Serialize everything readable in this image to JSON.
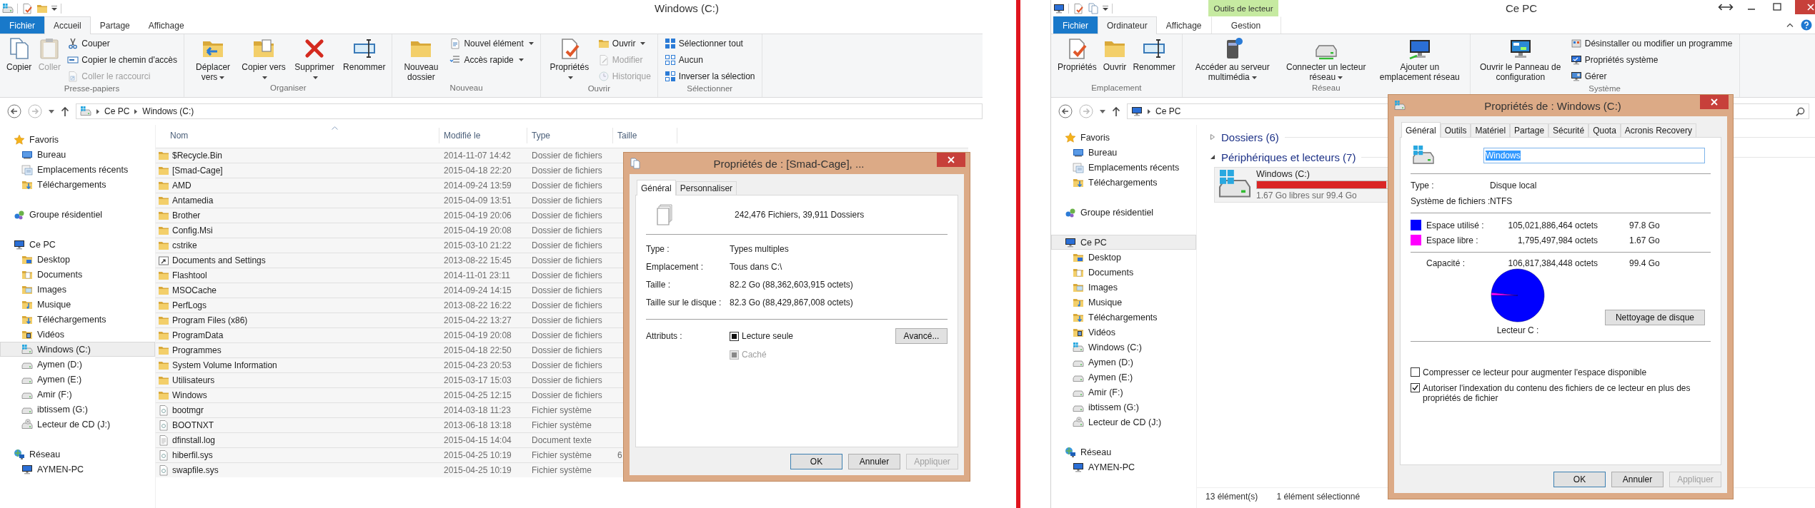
{
  "left_window": {
    "title": "Windows (C:)",
    "tabs": [
      {
        "label": "Fichier",
        "kind": "file",
        "selected": false
      },
      {
        "label": "Accueil",
        "kind": "plain",
        "selected": true
      },
      {
        "label": "Partage",
        "kind": "plain",
        "selected": false
      },
      {
        "label": "Affichage",
        "kind": "plain",
        "selected": false
      }
    ],
    "ribbon_groups": [
      {
        "label": "Presse-papiers",
        "large": [
          {
            "label": "Copier",
            "kind": "copy",
            "disabled": false
          },
          {
            "label": "Coller",
            "kind": "paste",
            "disabled": true
          }
        ],
        "small": [
          {
            "label": "Couper",
            "kind": "cut",
            "disabled": false
          },
          {
            "label": "Copier le chemin d'accès",
            "kind": "path",
            "disabled": false
          },
          {
            "label": "Coller le raccourci",
            "kind": "shortcut",
            "disabled": true
          }
        ]
      },
      {
        "label": "Organiser",
        "large": [
          {
            "label": "Déplacer vers",
            "kind": "move",
            "disabled": false,
            "dropdown": true
          },
          {
            "label": "Copier vers",
            "kind": "copyto",
            "disabled": false,
            "dropdown": true
          },
          {
            "label": "Supprimer",
            "kind": "delete",
            "disabled": false,
            "dropdown": true
          },
          {
            "label": "Renommer",
            "kind": "rename",
            "disabled": false
          }
        ]
      },
      {
        "label": "Nouveau",
        "large": [
          {
            "label": "Nouveau dossier",
            "kind": "newfolder",
            "disabled": false
          }
        ],
        "small": [
          {
            "label": "Nouvel élément",
            "kind": "newitem",
            "disabled": false,
            "dropdown": true
          },
          {
            "label": "Accès rapide",
            "kind": "quick",
            "disabled": false,
            "dropdown": true
          }
        ]
      },
      {
        "label": "Ouvrir",
        "large": [
          {
            "label": "Propriétés",
            "kind": "properties",
            "disabled": false,
            "dropdown": true
          }
        ],
        "small": [
          {
            "label": "Ouvrir",
            "kind": "open",
            "disabled": false,
            "dropdown": true
          },
          {
            "label": "Modifier",
            "kind": "edit",
            "disabled": true
          },
          {
            "label": "Historique",
            "kind": "history",
            "disabled": true
          }
        ]
      },
      {
        "label": "Sélectionner",
        "small": [
          {
            "label": "Sélectionner tout",
            "kind": "selectall",
            "disabled": false
          },
          {
            "label": "Aucun",
            "kind": "selectnone",
            "disabled": false
          },
          {
            "label": "Inverser la sélection",
            "kind": "invert",
            "disabled": false
          }
        ]
      }
    ],
    "address": [
      "Ce PC",
      "Windows (C:)"
    ],
    "sidebar": [
      {
        "label": "Favoris",
        "kind": "star",
        "selected": false,
        "children": [
          {
            "label": "Bureau",
            "kind": "desktop",
            "selected": false
          },
          {
            "label": "Emplacements récents",
            "kind": "recent",
            "selected": false
          },
          {
            "label": "Téléchargements",
            "kind": "downloads",
            "selected": false
          }
        ]
      },
      {
        "label": "Groupe résidentiel",
        "kind": "homegroup",
        "selected": false
      },
      {
        "label": "Ce PC",
        "kind": "pc",
        "selected": false,
        "children": [
          {
            "label": "Desktop",
            "kind": "desktopfolder",
            "selected": false
          },
          {
            "label": "Documents",
            "kind": "documents",
            "selected": false
          },
          {
            "label": "Images",
            "kind": "pictures",
            "selected": false
          },
          {
            "label": "Musique",
            "kind": "music",
            "selected": false
          },
          {
            "label": "Téléchargements",
            "kind": "downloads",
            "selected": false
          },
          {
            "label": "Vidéos",
            "kind": "videos",
            "selected": false
          },
          {
            "label": "Windows (C:)",
            "kind": "windrive",
            "selected": true
          },
          {
            "label": "Aymen (D:)",
            "kind": "drive",
            "selected": false
          },
          {
            "label": "Aymen (E:)",
            "kind": "drive",
            "selected": false
          },
          {
            "label": "Amir (F:)",
            "kind": "drive",
            "selected": false
          },
          {
            "label": "ibtissem (G:)",
            "kind": "drive",
            "selected": false
          },
          {
            "label": "Lecteur de CD (J:)",
            "kind": "cd",
            "selected": false
          }
        ]
      },
      {
        "label": "Réseau",
        "kind": "network",
        "selected": false,
        "children": [
          {
            "label": "AYMEN-PC",
            "kind": "pc",
            "selected": false
          }
        ]
      }
    ],
    "columns": [
      "Nom",
      "Modifié le",
      "Type",
      "Taille"
    ],
    "rows": [
      {
        "name": "$Recycle.Bin",
        "kind": "folder",
        "modified": "2014-11-07 14:42",
        "type": "Dossier de fichiers"
      },
      {
        "name": "[Smad-Cage]",
        "kind": "folder",
        "modified": "2015-04-18 22:20",
        "type": "Dossier de fichiers"
      },
      {
        "name": "AMD",
        "kind": "folder",
        "modified": "2014-09-24 13:59",
        "type": "Dossier de fichiers"
      },
      {
        "name": "Antamedia",
        "kind": "folder",
        "modified": "2015-04-09 13:51",
        "type": "Dossier de fichiers"
      },
      {
        "name": "Brother",
        "kind": "folder",
        "modified": "2015-04-19 20:06",
        "type": "Dossier de fichiers"
      },
      {
        "name": "Config.Msi",
        "kind": "folder",
        "modified": "2015-04-19 20:08",
        "type": "Dossier de fichiers"
      },
      {
        "name": "cstrike",
        "kind": "folder",
        "modified": "2015-03-10 21:22",
        "type": "Dossier de fichiers"
      },
      {
        "name": "Documents and Settings",
        "kind": "link",
        "modified": "2013-08-22 15:45",
        "type": "Dossier de fichiers"
      },
      {
        "name": "Flashtool",
        "kind": "folder",
        "modified": "2014-11-01 23:11",
        "type": "Dossier de fichiers"
      },
      {
        "name": "MSOCache",
        "kind": "folder",
        "modified": "2014-09-24 14:15",
        "type": "Dossier de fichiers"
      },
      {
        "name": "PerfLogs",
        "kind": "folder",
        "modified": "2013-08-22 16:22",
        "type": "Dossier de fichiers"
      },
      {
        "name": "Program Files (x86)",
        "kind": "folder",
        "modified": "2015-04-22 13:27",
        "type": "Dossier de fichiers"
      },
      {
        "name": "ProgramData",
        "kind": "folder",
        "modified": "2015-04-19 20:08",
        "type": "Dossier de fichiers"
      },
      {
        "name": "Programmes",
        "kind": "folder",
        "modified": "2015-04-18 22:50",
        "type": "Dossier de fichiers"
      },
      {
        "name": "System Volume Information",
        "kind": "folder",
        "modified": "2015-04-23 20:53",
        "type": "Dossier de fichiers"
      },
      {
        "name": "Utilisateurs",
        "kind": "folder",
        "modified": "2015-03-17 15:03",
        "type": "Dossier de fichiers"
      },
      {
        "name": "Windows",
        "kind": "folder",
        "modified": "2015-04-25 12:15",
        "type": "Dossier de fichiers"
      },
      {
        "name": "bootmgr",
        "kind": "sysfile",
        "modified": "2014-03-18 11:23",
        "type": "Fichier système"
      },
      {
        "name": "BOOTNXT",
        "kind": "sysfile",
        "modified": "2013-06-18 13:18",
        "type": "Fichier système"
      },
      {
        "name": "dfinstall.log",
        "kind": "textfile",
        "modified": "2015-04-15 14:04",
        "type": "Document texte"
      },
      {
        "name": "hiberfil.sys",
        "kind": "sysfile",
        "modified": "2015-04-25 10:19",
        "type": "Fichier système",
        "size": "6"
      },
      {
        "name": "swapfile.sys",
        "kind": "sysfile",
        "modified": "2015-04-25 10:19",
        "type": "Fichier système"
      }
    ]
  },
  "left_dialog": {
    "title": "Propriétés de : [Smad-Cage], ...",
    "tabs": [
      {
        "label": "Général",
        "selected": true
      },
      {
        "label": "Personnaliser",
        "selected": false
      }
    ],
    "summary": "242,476 Fichiers, 39,911 Dossiers",
    "fields": [
      {
        "label": "Type :",
        "value": "Types multiples"
      },
      {
        "label": "Emplacement :",
        "value": "Tous dans C:\\"
      },
      {
        "label": "Taille :",
        "value": "82.2 Go (88,362,603,915 octets)"
      },
      {
        "label": "Taille sur le disque :",
        "value": "82.3 Go (88,429,867,008 octets)"
      }
    ],
    "attributes_label": "Attributs :",
    "attributes": [
      {
        "label": "Lecture seule",
        "indeterminate": true,
        "disabled": false
      },
      {
        "label": "Caché",
        "indeterminate": true,
        "disabled": true
      }
    ],
    "advanced_button": "Avancé...",
    "buttons": [
      {
        "label": "OK",
        "default": true,
        "disabled": false
      },
      {
        "label": "Annuler",
        "default": false,
        "disabled": false
      },
      {
        "label": "Appliquer",
        "default": false,
        "disabled": true
      }
    ]
  },
  "right_window": {
    "title": "Ce PC",
    "context_tab": "Outils de lecteur",
    "tabs": [
      {
        "label": "Fichier",
        "kind": "file",
        "selected": false
      },
      {
        "label": "Ordinateur",
        "kind": "plain",
        "selected": true
      },
      {
        "label": "Affichage",
        "kind": "plain",
        "selected": false
      },
      {
        "label": "Gestion",
        "kind": "context",
        "selected": false
      }
    ],
    "ribbon_groups": [
      {
        "label": "Emplacement",
        "large": [
          {
            "label": "Propriétés",
            "kind": "properties",
            "disabled": false
          },
          {
            "label": "Ouvrir",
            "kind": "open",
            "disabled": false
          },
          {
            "label": "Renommer",
            "kind": "rename",
            "disabled": false
          }
        ]
      },
      {
        "label": "Réseau",
        "large": [
          {
            "label": "Accéder au serveur multimédia",
            "kind": "media",
            "disabled": false,
            "dropdown": true
          },
          {
            "label": "Connecter un lecteur réseau",
            "kind": "netdrive",
            "disabled": false,
            "dropdown": true
          },
          {
            "label": "Ajouter un emplacement réseau",
            "kind": "netloc",
            "disabled": false
          }
        ]
      },
      {
        "label": "Système",
        "large": [
          {
            "label": "Ouvrir le Panneau de configuration",
            "kind": "panel",
            "disabled": false
          }
        ],
        "small": [
          {
            "label": "Désinstaller ou modifier un programme",
            "kind": "uninstall",
            "disabled": false
          },
          {
            "label": "Propriétés système",
            "kind": "sysprops",
            "disabled": false
          },
          {
            "label": "Gérer",
            "kind": "manage",
            "disabled": false
          }
        ]
      }
    ],
    "address": [
      "Ce PC"
    ],
    "sidebar": [
      {
        "label": "Favoris",
        "kind": "star",
        "selected": false,
        "children": [
          {
            "label": "Bureau",
            "kind": "desktop",
            "selected": false
          },
          {
            "label": "Emplacements récents",
            "kind": "recent",
            "selected": false
          },
          {
            "label": "Téléchargements",
            "kind": "downloads",
            "selected": false
          }
        ]
      },
      {
        "label": "Groupe résidentiel",
        "kind": "homegroup",
        "selected": false
      },
      {
        "label": "Ce PC",
        "kind": "pc",
        "selected": true,
        "children": [
          {
            "label": "Desktop",
            "kind": "desktopfolder",
            "selected": false
          },
          {
            "label": "Documents",
            "kind": "documents",
            "selected": false
          },
          {
            "label": "Images",
            "kind": "pictures",
            "selected": false
          },
          {
            "label": "Musique",
            "kind": "music",
            "selected": false
          },
          {
            "label": "Téléchargements",
            "kind": "downloads",
            "selected": false
          },
          {
            "label": "Vidéos",
            "kind": "videos",
            "selected": false
          },
          {
            "label": "Windows (C:)",
            "kind": "windrive",
            "selected": false
          },
          {
            "label": "Aymen (D:)",
            "kind": "drive",
            "selected": false
          },
          {
            "label": "Aymen (E:)",
            "kind": "drive",
            "selected": false
          },
          {
            "label": "Amir (F:)",
            "kind": "drive",
            "selected": false
          },
          {
            "label": "ibtissem (G:)",
            "kind": "drive",
            "selected": false
          },
          {
            "label": "Lecteur de CD (J:)",
            "kind": "cd",
            "selected": false
          }
        ]
      },
      {
        "label": "Réseau",
        "kind": "network",
        "selected": false,
        "children": [
          {
            "label": "AYMEN-PC",
            "kind": "pc",
            "selected": false
          }
        ]
      }
    ],
    "sections": [
      {
        "label": "Dossiers (6)",
        "expanded": false
      },
      {
        "label": "Périphériques et lecteurs (7)",
        "expanded": true
      }
    ],
    "drive_tile": {
      "name": "Windows (C:)",
      "level": 0.983,
      "free": "1.67 Go libres sur 99.4 Go"
    },
    "status": [
      "13 élément(s)",
      "1 élément sélectionné"
    ]
  },
  "right_dialog": {
    "title": "Propriétés de : Windows (C:)",
    "tabs": [
      {
        "label": "Général",
        "selected": true
      },
      {
        "label": "Outils",
        "selected": false
      },
      {
        "label": "Matériel",
        "selected": false
      },
      {
        "label": "Partage",
        "selected": false
      },
      {
        "label": "Sécurité",
        "selected": false
      },
      {
        "label": "Quota",
        "selected": false
      },
      {
        "label": "Acronis Recovery",
        "selected": false
      }
    ],
    "name_field": "Windows",
    "fields": [
      {
        "label": "Type :",
        "value": "Disque local"
      },
      {
        "label": "Système de fichiers :",
        "value": "NTFS"
      }
    ],
    "usage": [
      {
        "label": "Espace utilisé :",
        "bytes": "105,021,886,464 octets",
        "size": "97.8 Go",
        "color": "#0000ff"
      },
      {
        "label": "Espace libre :",
        "bytes": "1,795,497,984 octets",
        "size": "1.67 Go",
        "color": "#ff00ff"
      }
    ],
    "capacity": {
      "label": "Capacité :",
      "bytes": "106,817,384,448 octets",
      "size": "99.4 Go"
    },
    "chart_data": {
      "type": "pie",
      "values": [
        97.8,
        1.67
      ]
    },
    "drive_label": "Lecteur C :",
    "cleanup_button": "Nettoyage de disque",
    "options": [
      {
        "label": "Compresser ce lecteur pour augmenter l'espace disponible",
        "checked": false
      },
      {
        "label": "Autoriser l'indexation du contenu des fichiers de ce lecteur en plus des propriétés de fichier",
        "checked": true
      }
    ],
    "buttons": [
      {
        "label": "OK",
        "default": true,
        "disabled": false
      },
      {
        "label": "Annuler",
        "default": false,
        "disabled": false
      },
      {
        "label": "Appliquer",
        "default": false,
        "disabled": true
      }
    ]
  }
}
